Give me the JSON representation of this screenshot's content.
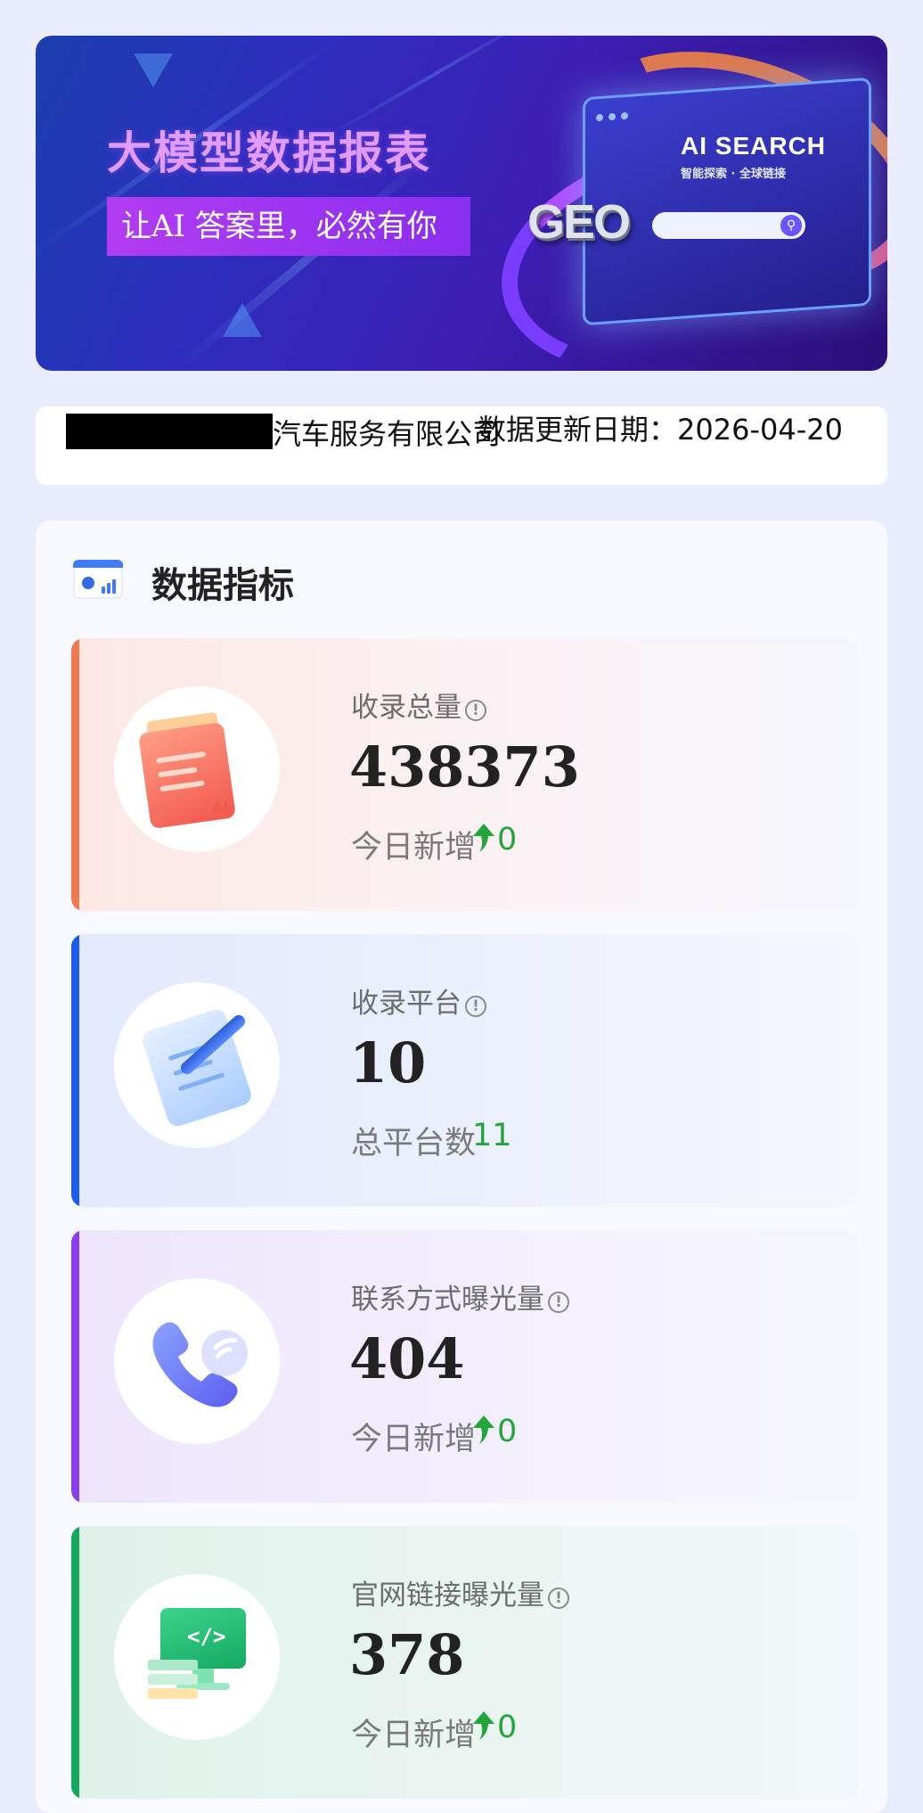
{
  "banner": {
    "title": "大模型数据报表",
    "subtitle": "让AI 答案里，必然有你",
    "screen_title": "AI SEARCH",
    "screen_tagline": "智能探索 · 全球链接",
    "logo_text": "GEO"
  },
  "company": {
    "name_visible": "汽车服务有限公司",
    "update_label": "数据更新日期：",
    "update_date": "2026-04-20"
  },
  "section": {
    "title": "数据指标",
    "info_glyph": "!"
  },
  "cards": [
    {
      "label": "收录总量",
      "value": "438373",
      "sublabel": "今日新增",
      "delta": "0",
      "accent": "#f07a4e",
      "icon": "ai-document-icon"
    },
    {
      "label": "收录平台",
      "value": "10",
      "sublabel": "总平台数",
      "delta": "11",
      "accent": "#1c5cf0",
      "icon": "pen-notepad-icon"
    },
    {
      "label": "联系方式曝光量",
      "value": "404",
      "sublabel": "今日新增",
      "delta": "0",
      "accent": "#8a3ef0",
      "icon": "phone-icon"
    },
    {
      "label": "官网链接曝光量",
      "value": "378",
      "sublabel": "今日新增",
      "delta": "0",
      "accent": "#12a95a",
      "icon": "code-monitor-icon"
    }
  ],
  "colors": {
    "page_bg": "#e9ecfd",
    "positive": "#23a53c"
  }
}
